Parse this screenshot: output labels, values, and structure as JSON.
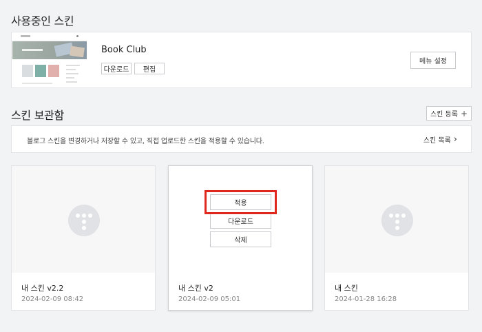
{
  "current_section": {
    "title": "사용중인 스킨",
    "skin_name": "Book Club",
    "download_label": "다운로드",
    "edit_label": "편집",
    "menu_settings_label": "메뉴 설정"
  },
  "storage_section": {
    "title": "스킨 보관함",
    "register_label": "스킨 등록",
    "info_text": "블로그 스킨을 변경하거나 저장할 수 있고, 직접 업로드한 스킨을 적용할 수 있습니다.",
    "list_link_label": "스킨 목록"
  },
  "skins": [
    {
      "name": "내 스킨 v2.2",
      "date": "2024-02-09 08:42"
    },
    {
      "name": "내 스킨 v2",
      "date": "2024-02-09 05:01",
      "actions": {
        "apply": "적용",
        "download": "다운로드",
        "delete": "삭제"
      }
    },
    {
      "name": "내 스킨",
      "date": "2024-01-28 16:28"
    }
  ],
  "colors": {
    "highlight": "#e0271d",
    "background": "#f2f3f5"
  }
}
